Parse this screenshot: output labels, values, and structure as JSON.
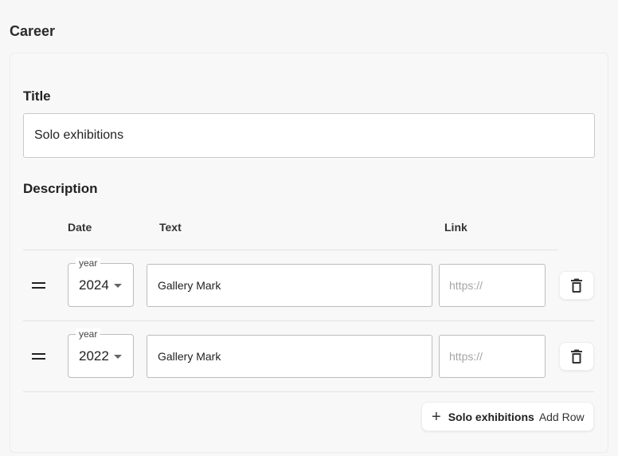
{
  "section": {
    "title": "Career"
  },
  "title_field": {
    "label": "Title",
    "value": "Solo exhibitions"
  },
  "description": {
    "label": "Description",
    "columns": [
      "Date",
      "Text",
      "Link"
    ],
    "rows": [
      {
        "year_label": "year",
        "year": "2024",
        "text": "Gallery Mark",
        "link_placeholder": "https://"
      },
      {
        "year_label": "year",
        "year": "2022",
        "text": "Gallery Mark",
        "link_placeholder": "https://"
      }
    ]
  },
  "add_row": {
    "prefix": "Solo exhibitions",
    "label": "Add Row",
    "icon": "plus-icon"
  }
}
